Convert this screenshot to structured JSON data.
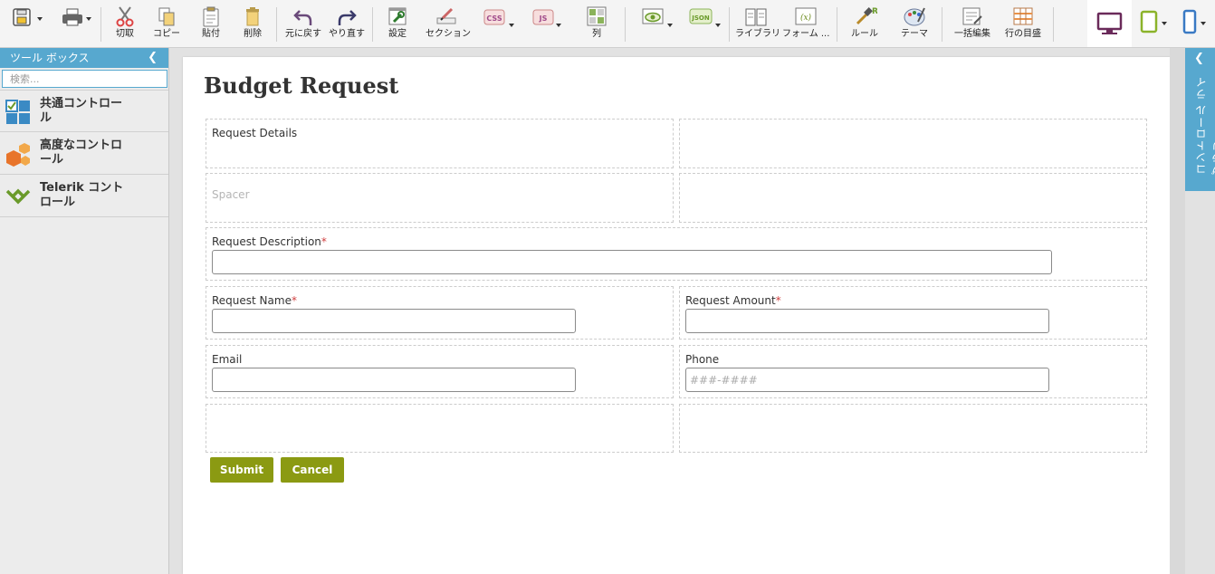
{
  "toolbar": {
    "buttons": [
      {
        "id": "cut",
        "label": "切取",
        "icon": "scissors-icon"
      },
      {
        "id": "copy",
        "label": "コピー",
        "icon": "copy-icon"
      },
      {
        "id": "paste",
        "label": "貼付",
        "icon": "clipboard-icon"
      },
      {
        "id": "delete",
        "label": "削除",
        "icon": "trash-icon"
      },
      {
        "id": "undo",
        "label": "元に戻す",
        "icon": "undo-icon"
      },
      {
        "id": "redo",
        "label": "やり直す",
        "icon": "redo-icon"
      },
      {
        "id": "settings",
        "label": "設定",
        "icon": "wrench-icon"
      },
      {
        "id": "section",
        "label": "セクション",
        "icon": "section-icon"
      },
      {
        "id": "column",
        "label": "列",
        "icon": "column-icon"
      },
      {
        "id": "library",
        "label": "ライブラリ",
        "icon": "book-icon"
      },
      {
        "id": "form",
        "label": "フォーム ...",
        "icon": "formula-icon"
      },
      {
        "id": "rules",
        "label": "ルール",
        "icon": "rules-icon"
      },
      {
        "id": "theme",
        "label": "テーマ",
        "icon": "palette-icon"
      },
      {
        "id": "bulk_edit",
        "label": "一括編集",
        "icon": "bulk-edit-icon"
      },
      {
        "id": "row_grid",
        "label": "行の目盛",
        "icon": "grid-icon"
      }
    ],
    "css_badge": "CSS",
    "js_badge": "JS",
    "json_badge": "JSON",
    "formula_glyph": "(x)",
    "rules_glyph": "R"
  },
  "toolbox": {
    "title": "ツール ボックス",
    "search_placeholder": "検索...",
    "items": [
      {
        "label": "共通コントロール",
        "icon": "common-controls-icon"
      },
      {
        "label": "高度なコントロール",
        "icon": "advanced-controls-icon"
      },
      {
        "label": "Telerik コントロール",
        "icon": "telerik-icon"
      }
    ]
  },
  "library_panel": {
    "label": "コントロール ライブラリ"
  },
  "form": {
    "title": "Budget Request",
    "request_details_label": "Request Details",
    "spacer_label": "Spacer",
    "request_description_label": "Request Description",
    "request_name_label": "Request Name",
    "request_amount_label": "Request Amount",
    "email_label": "Email",
    "phone_label": "Phone",
    "phone_placeholder": "###-####",
    "required_mark": "*",
    "submit_label": "Submit",
    "cancel_label": "Cancel"
  },
  "colors": {
    "accent": "#57a8cf",
    "button": "#8b9a12",
    "required": "#d04040"
  }
}
